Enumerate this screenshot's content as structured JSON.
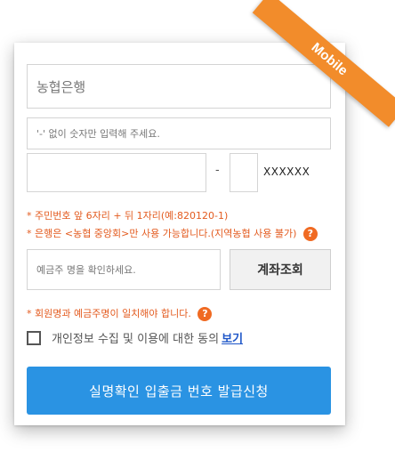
{
  "form": {
    "bank_select": "농협은행",
    "account_placeholder": "'-' 없이 숫자만 입력해 주세요.",
    "id_dash": "-",
    "id_back_mask": "XXXXXX",
    "note_id": "* 주민번호 앞 6자리 + 뒤 1자리(예:820120-1)",
    "note_bank": "* 은행은 <농협 중앙회>만 사용 가능합니다.(지역농협 사용 불가)",
    "holder_placeholder": "예금주 명을 확인하세요.",
    "verify_label": "계좌조회",
    "note_match": "* 회원명과 예금주명이 일치해야 합니다.",
    "help_glyph": "?",
    "consent_text": "개인정보 수집 및 이용에 대한 동의",
    "consent_link": "보기",
    "submit_label": "실명확인 입출금 번호 발급신청"
  },
  "ribbon": {
    "label": "Mobile"
  },
  "colors": {
    "accent_blue": "#2a93e3",
    "note_orange": "#e35b1f",
    "ribbon_orange": "#f28c2b",
    "link_blue": "#1e56c8"
  }
}
